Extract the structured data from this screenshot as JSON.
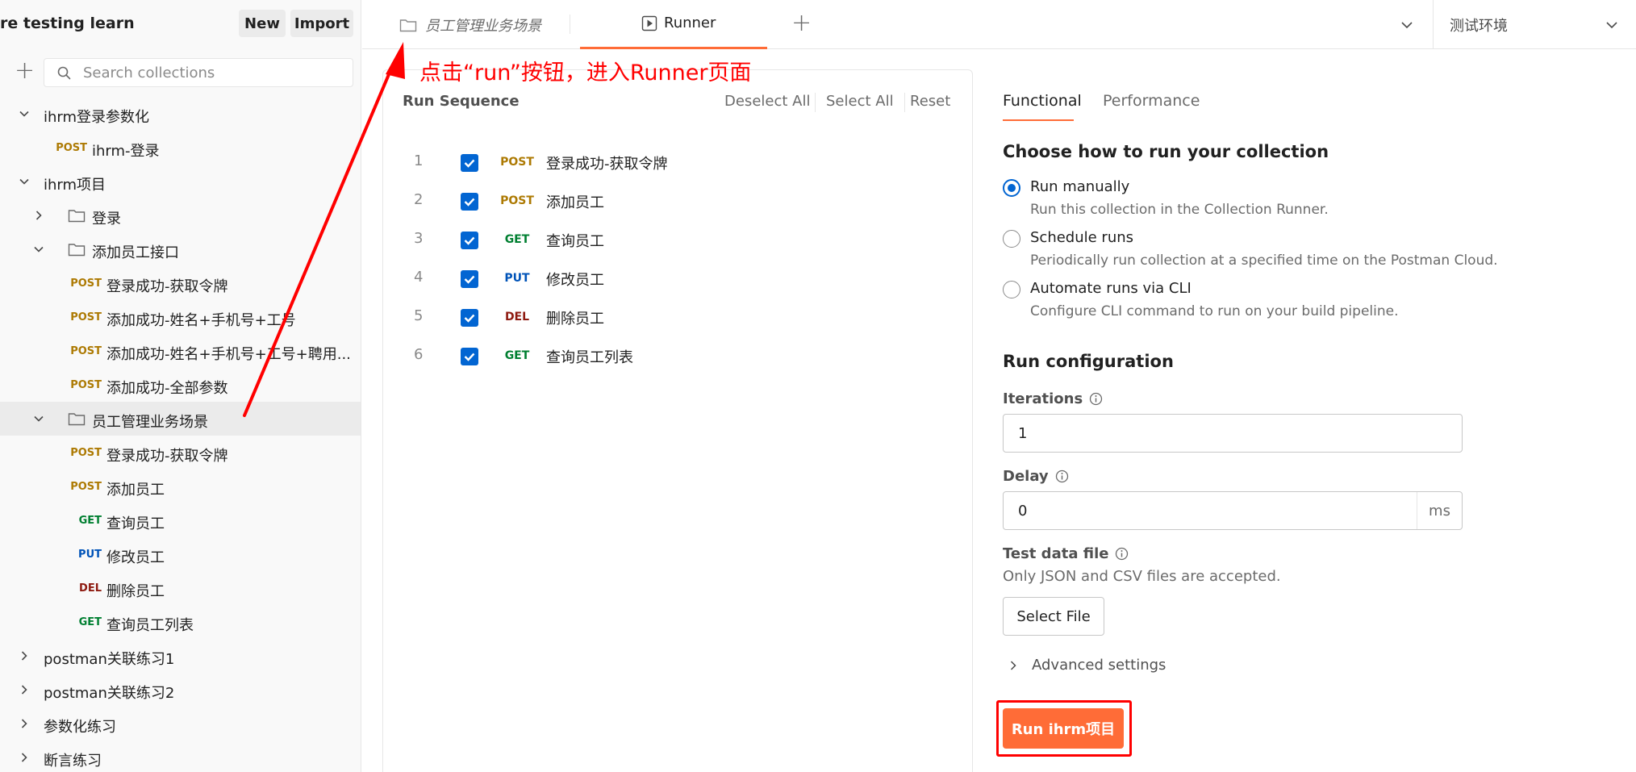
{
  "sidebar": {
    "workspace_name": "re testing learn",
    "new_label": "New",
    "import_label": "Import",
    "search_placeholder": "Search collections",
    "tree": [
      {
        "label": "ihrm登录参数化",
        "type": "collection",
        "expanded": true
      },
      {
        "label": "ihrm-登录",
        "type": "request",
        "method": "POST"
      },
      {
        "label": "ihrm项目",
        "type": "collection",
        "expanded": true
      },
      {
        "label": "登录",
        "type": "folder",
        "expanded": false
      },
      {
        "label": "添加员工接口",
        "type": "folder",
        "expanded": true
      },
      {
        "label": "登录成功-获取令牌",
        "type": "request",
        "method": "POST"
      },
      {
        "label": "添加成功-姓名+手机号+工号",
        "type": "request",
        "method": "POST"
      },
      {
        "label": "添加成功-姓名+手机号+工号+聘用...",
        "type": "request",
        "method": "POST"
      },
      {
        "label": "添加成功-全部参数",
        "type": "request",
        "method": "POST"
      },
      {
        "label": "员工管理业务场景",
        "type": "folder",
        "expanded": true,
        "selected": true
      },
      {
        "label": "登录成功-获取令牌",
        "type": "request",
        "method": "POST"
      },
      {
        "label": "添加员工",
        "type": "request",
        "method": "POST"
      },
      {
        "label": "查询员工",
        "type": "request",
        "method": "GET"
      },
      {
        "label": "修改员工",
        "type": "request",
        "method": "PUT"
      },
      {
        "label": "删除员工",
        "type": "request",
        "method": "DEL"
      },
      {
        "label": "查询员工列表",
        "type": "request",
        "method": "GET"
      },
      {
        "label": "postman关联练习1",
        "type": "collection",
        "expanded": false
      },
      {
        "label": "postman关联练习2",
        "type": "collection",
        "expanded": false
      },
      {
        "label": "参数化练习",
        "type": "collection",
        "expanded": false
      },
      {
        "label": "断言练习",
        "type": "collection",
        "expanded": false
      }
    ]
  },
  "tabs": {
    "scenario_label": "员工管理业务场景",
    "runner_label": "Runner",
    "add_label": "+",
    "environment": "测试环境"
  },
  "run_sequence": {
    "title": "Run Sequence",
    "deselect_all": "Deselect All",
    "select_all": "Select All",
    "reset": "Reset",
    "items": [
      {
        "num": "1",
        "method": "POST",
        "name": "登录成功-获取令牌",
        "checked": true
      },
      {
        "num": "2",
        "method": "POST",
        "name": "添加员工",
        "checked": true
      },
      {
        "num": "3",
        "method": "GET",
        "name": "查询员工",
        "checked": true
      },
      {
        "num": "4",
        "method": "PUT",
        "name": "修改员工",
        "checked": true
      },
      {
        "num": "5",
        "method": "DEL",
        "name": "删除员工",
        "checked": true
      },
      {
        "num": "6",
        "method": "GET",
        "name": "查询员工列表",
        "checked": true
      }
    ]
  },
  "config": {
    "tab_functional": "Functional",
    "tab_performance": "Performance",
    "choose_heading": "Choose how to run your collection",
    "options": [
      {
        "label": "Run manually",
        "desc": "Run this collection in the Collection Runner.",
        "selected": true
      },
      {
        "label": "Schedule runs",
        "desc": "Periodically run collection at a specified time on the Postman Cloud.",
        "selected": false
      },
      {
        "label": "Automate runs via CLI",
        "desc": "Configure CLI command to run on your build pipeline.",
        "selected": false
      }
    ],
    "run_config_heading": "Run configuration",
    "iterations_label": "Iterations",
    "iterations_value": "1",
    "delay_label": "Delay",
    "delay_value": "0",
    "delay_unit": "ms",
    "test_data_label": "Test data file",
    "test_data_hint": "Only JSON and CSV files are accepted.",
    "select_file": "Select File",
    "advanced": "Advanced settings",
    "run_button": "Run ihrm项目"
  },
  "annotation": {
    "text": "点击“run”按钮，进入Runner页面"
  },
  "colors": {
    "accent": "#ff6c37",
    "checkbox": "#0265d2",
    "annotation": "#ff0000",
    "post": "#ad7a03",
    "get": "#007f31",
    "put": "#0053b8",
    "del": "#8e1a10"
  }
}
